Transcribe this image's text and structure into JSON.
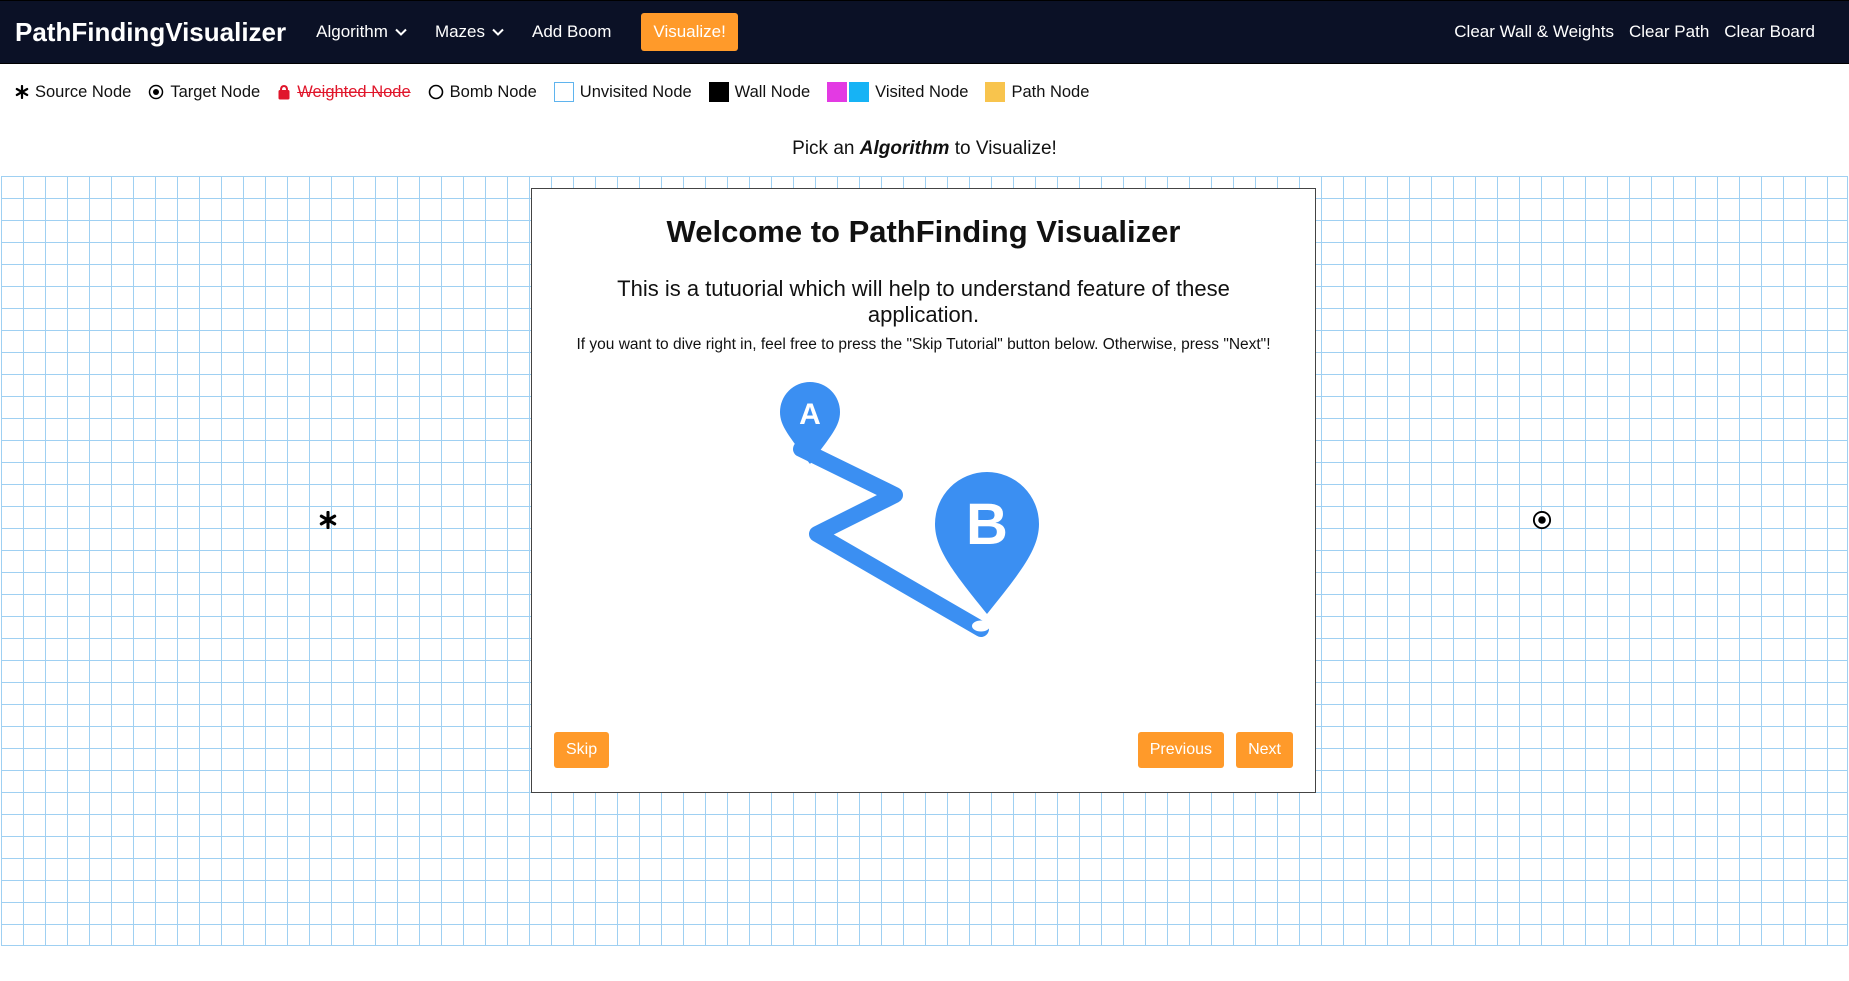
{
  "navbar": {
    "brand": "PathFindingVisualizer",
    "algorithm": "Algorithm",
    "mazes": "Mazes",
    "add_bomb": "Add Boom",
    "visualize": "Visualize!",
    "clear_walls": "Clear Wall & Weights",
    "clear_path": "Clear Path",
    "clear_board": "Clear Board"
  },
  "legend": {
    "source": "Source Node",
    "target": "Target Node",
    "weighted": "Weighted Node",
    "bomb": "Bomb Node",
    "unvisited": "Unvisited Node",
    "wall": "Wall Node",
    "visited": "Visited Node",
    "path": "Path Node"
  },
  "subtitle": {
    "prefix": "Pick an",
    "emph": "Algorithm",
    "suffix": "to Visualize!"
  },
  "modal": {
    "title": "Welcome to PathFinding Visualizer",
    "subtitle": "This is a tutuorial which will help to understand feature of these application.",
    "text": "If you want to dive right in, feel free to press the \"Skip Tutorial\" button below. Otherwise, press \"Next\"!",
    "marker_a": "A",
    "marker_b": "B",
    "skip": "Skip",
    "previous": "Previous",
    "next": "Next"
  },
  "colors": {
    "navbar": "#0b1126",
    "accent": "#ff9a2a",
    "grid_line": "#9fd0f2",
    "illustration": "#3b8ff2",
    "weighted": "#e0162b",
    "visited_1": "#e33ae3",
    "visited_2": "#16b3f5",
    "path": "#f8c44d"
  }
}
